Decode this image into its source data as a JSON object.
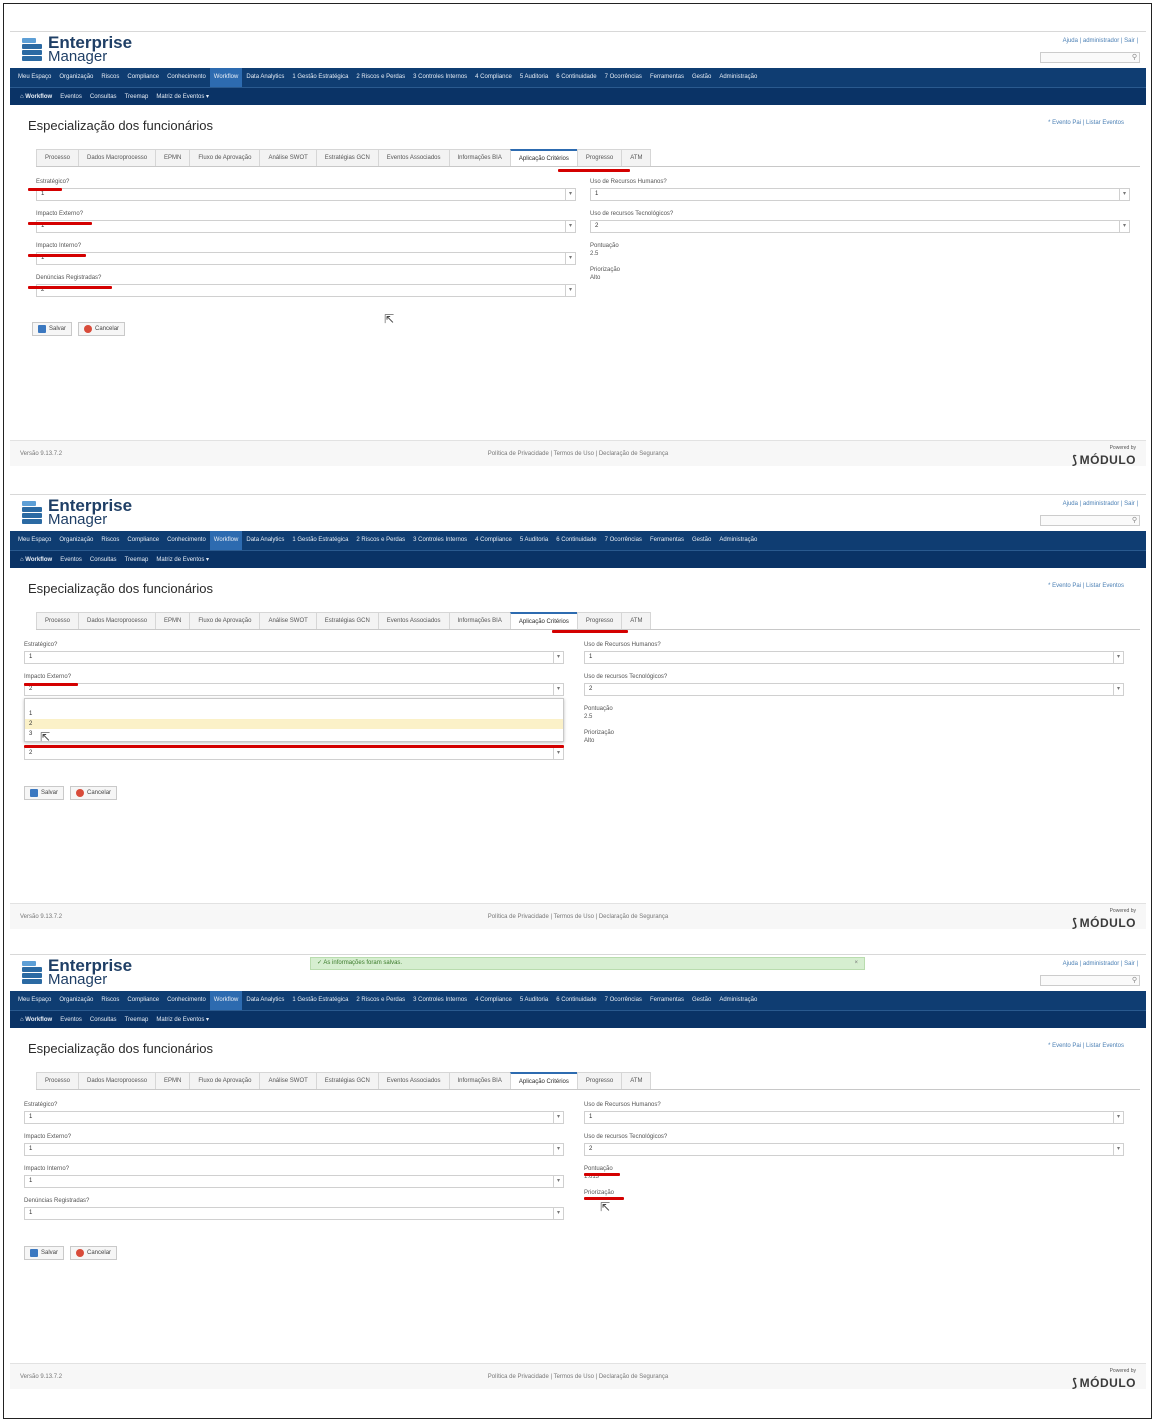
{
  "app": {
    "logo_line1": "Enterprise",
    "logo_line2": "Manager",
    "top_links": "Ajuda | administrador | Sair |",
    "search_icon": "magnifier-icon"
  },
  "main_menu": [
    "Meu Espaço",
    "Organização",
    "Riscos",
    "Compliance",
    "Conhecimento",
    "Workflow",
    "Data Analytics",
    "1 Gestão Estratégica",
    "2 Riscos e Perdas",
    "3 Controles Internos",
    "4 Compliance",
    "5 Auditoria",
    "6 Continuidade",
    "7 Ocorrências",
    "Ferramentas",
    "Gestão",
    "Administração"
  ],
  "main_menu_active": "Workflow",
  "sub_menu": {
    "home": "Workflow",
    "items": [
      "Eventos",
      "Consultas",
      "Treemap",
      "Matriz de Eventos ▾"
    ]
  },
  "page": {
    "title": "Especialização dos funcionários",
    "links": "* Evento Pai | Listar Eventos"
  },
  "tabs": [
    "Processo",
    "Dados Macroprocesso",
    "EPMN",
    "Fluxo de Aprovação",
    "Análise SWOT",
    "Estratégias GCN",
    "Eventos Associados",
    "Informações BIA",
    "Aplicação Critérios",
    "Progresso",
    "ATM"
  ],
  "active_tab": "Aplicação Critérios",
  "labels": {
    "estrategico": "Estratégico?",
    "impacto_externo": "Impacto Externo?",
    "impacto_interno": "Impacto Interno?",
    "denuncias": "Denúncias Registradas?",
    "recursos_humanos": "Uso de Recursos Humanos?",
    "recursos_tecnologicos": "Uso de recursos Tecnológicos?",
    "pontuacao": "Pontuação",
    "priorizacao": "Priorização"
  },
  "buttons": {
    "save": "Salvar",
    "cancel": "Cancelar"
  },
  "footer": {
    "version": "Versão 9.13.7.2",
    "links": "Política de Privacidade | Termos de Uso | Declaração de Segurança",
    "powered": "Powered by",
    "brand": "MÓDULO"
  },
  "notice": "As informações foram salvas.",
  "screens": [
    {
      "values": {
        "estrategico": "1",
        "impacto_externo": "1",
        "impacto_interno": "1",
        "denuncias": "2",
        "recursos_humanos": "1",
        "recursos_tecnologicos": "2",
        "pontuacao": "2.5",
        "priorizacao": "Alto"
      }
    },
    {
      "values": {
        "estrategico": "1",
        "impacto_externo": "2",
        "impacto_interno": "",
        "denuncias": "2",
        "recursos_humanos": "1",
        "recursos_tecnologicos": "2",
        "pontuacao": "2.5",
        "priorizacao": "Alto"
      },
      "dropdown_options": [
        "",
        "1",
        "2",
        "3"
      ],
      "dropdown_highlight": "2"
    },
    {
      "values": {
        "estrategico": "1",
        "impacto_externo": "1",
        "impacto_interno": "1",
        "denuncias": "1",
        "recursos_humanos": "1",
        "recursos_tecnologicos": "2",
        "pontuacao": "1.613",
        "priorizacao": ""
      }
    }
  ],
  "accent_colors": {
    "menu_bg": "#0f3d72",
    "active_menu": "#2d6bb0",
    "highlight": "#d40000",
    "notice_bg": "#d6eed0"
  }
}
